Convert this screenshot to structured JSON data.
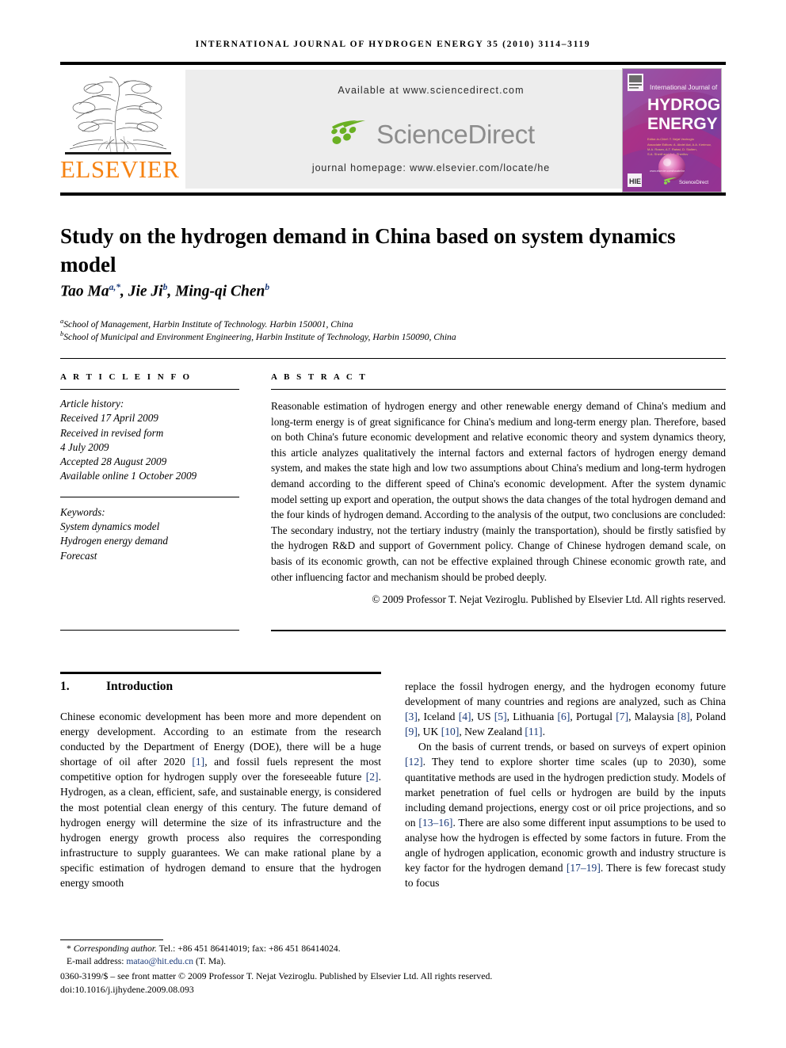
{
  "running_head": "INTERNATIONAL JOURNAL OF HYDROGEN ENERGY 35 (2010) 3114–3119",
  "masthead": {
    "publisher_wordmark": "ELSEVIER",
    "available_at": "Available at www.sciencedirect.com",
    "sciencedirect_wordmark": "ScienceDirect",
    "journal_homepage": "journal homepage: www.elsevier.com/locate/he",
    "cover": {
      "line1": "International Journal of",
      "line2": "HYDROGEN",
      "line3": "ENERGY",
      "editor_block": "Editor-in-Chief: T. Nejat Veziroglu   Associate Editors: A. Abdel Aal, A.A. Kerimov, M.A. Rosen, A.T. Raissi, D. Stolten, S.A. Sherif and S.A. Sherifov",
      "badge": "HIE",
      "sciencedirect_label": "ScienceDirect"
    },
    "colors": {
      "elsevier_orange": "#f68212",
      "sciencedirect_green": "#6ab023",
      "sciencedirect_gray": "#8c8c8c",
      "band_gray": "#ededed",
      "cover_magenta": "#a0207a",
      "cover_purple": "#6b3f9e"
    }
  },
  "article": {
    "title": "Study on the hydrogen demand in China based on system dynamics model",
    "authors": [
      {
        "name": "Tao Ma",
        "sup": "a,*"
      },
      {
        "name": "Jie Ji",
        "sup": "b"
      },
      {
        "name": "Ming-qi Chen",
        "sup": "b"
      }
    ],
    "affiliations": [
      {
        "marker": "a",
        "text": "School of Management, Harbin Institute of Technology. Harbin 150001, China"
      },
      {
        "marker": "b",
        "text": "School of Municipal and Environment Engineering, Harbin Institute of Technology, Harbin 150090, China"
      }
    ]
  },
  "info": {
    "heading": "A R T I C L E   I N F O",
    "history_label": "Article history:",
    "history": [
      "Received 17 April 2009",
      "Received in revised form",
      "4 July 2009",
      "Accepted 28 August 2009",
      "Available online 1 October 2009"
    ],
    "keywords_label": "Keywords:",
    "keywords": [
      "System dynamics model",
      "Hydrogen energy demand",
      "Forecast"
    ]
  },
  "abstract": {
    "heading": "A B S T R A C T",
    "text": "Reasonable estimation of hydrogen energy and other renewable energy demand of China's medium and long-term energy is of great significance for China's medium and long-term energy plan. Therefore, based on both China's future economic development and relative economic theory and system dynamics theory, this article analyzes qualitatively the internal factors and external factors of hydrogen energy demand system, and makes the state high and low two assumptions about China's medium and long-term hydrogen demand according to the different speed of China's economic development. After the system dynamic model setting up export and operation, the output shows the data changes of the total hydrogen demand and the four kinds of hydrogen demand. According to the analysis of the output, two conclusions are concluded: The secondary industry, not the tertiary industry (mainly the transportation), should be firstly satisfied by the hydrogen R&D and support of Government policy. Change of Chinese hydrogen demand scale, on basis of its economic growth, can not be effective explained through Chinese economic growth rate, and other influencing factor and mechanism should be probed deeply.",
    "copyright": "© 2009 Professor T. Nejat Veziroglu. Published by Elsevier Ltd. All rights reserved."
  },
  "body": {
    "section_number": "1.",
    "section_title": "Introduction",
    "left_paragraph_1_a": "Chinese economic development has been more and more dependent on energy development. According to an estimate from the research conducted by the Department of Energy (DOE), there will be a huge shortage of oil after 2020 ",
    "ref_1": "[1]",
    "left_paragraph_1_b": ", and fossil fuels represent the most competitive option for hydrogen supply over the foreseeable future ",
    "ref_2": "[2]",
    "left_paragraph_1_c": ". Hydrogen, as a clean, efficient, safe, and sustainable energy, is considered the most potential clean energy of this century. The future demand of hydrogen energy will determine the size of its infrastructure and the hydrogen energy growth process also requires the corresponding infrastructure to supply guarantees. We can make rational plane by a specific estimation of hydrogen demand to ensure that the hydrogen energy smooth",
    "right_paragraph_1_a": "replace the fossil hydrogen energy, and the hydrogen economy future development of many countries and regions are analyzed, such as China ",
    "ref_3": "[3]",
    "right_p1_b": ", Iceland ",
    "ref_4": "[4]",
    "right_p1_c": ", US ",
    "ref_5": "[5]",
    "right_p1_d": ", Lithuania ",
    "ref_6": "[6]",
    "right_p1_e": ", Portugal ",
    "ref_7": "[7]",
    "right_p1_f": ", Malaysia ",
    "ref_8": "[8]",
    "right_p1_g": ", Poland ",
    "ref_9": "[9]",
    "right_p1_h": ", UK ",
    "ref_10": "[10]",
    "right_p1_i": ", New Zealand ",
    "ref_11": "[11]",
    "right_p1_j": ".",
    "right_paragraph_2_a": "On the basis of current trends, or based on surveys of expert opinion ",
    "ref_12": "[12]",
    "right_p2_b": ". They tend to explore shorter time scales (up to 2030), some quantitative methods are used in the hydrogen prediction study. Models of market penetration of fuel cells or hydrogen are build by the inputs including demand projections, energy cost or oil price projections, and so on ",
    "ref_13_16": "[13–16]",
    "right_p2_c": ". There are also some different input assumptions to be used to analyse how the hydrogen is effected by some factors in future. From the angle of hydrogen application, economic growth and industry structure is key factor for the hydrogen demand ",
    "ref_17_19": "[17–19]",
    "right_p2_d": ". There is few forecast study to focus"
  },
  "footer": {
    "corresponding_marker": "*",
    "corresponding_label": "Corresponding author.",
    "corresponding_contact": " Tel.: +86 451 86414019; fax: +86 451 86414024.",
    "email_label": "E-mail address: ",
    "email": "matao@hit.edu.cn",
    "email_suffix": " (T. Ma).",
    "imprint_line": "0360-3199/$ – see front matter © 2009 Professor T. Nejat Veziroglu. Published by Elsevier Ltd. All rights reserved.",
    "doi": "doi:10.1016/j.ijhydene.2009.08.093"
  }
}
